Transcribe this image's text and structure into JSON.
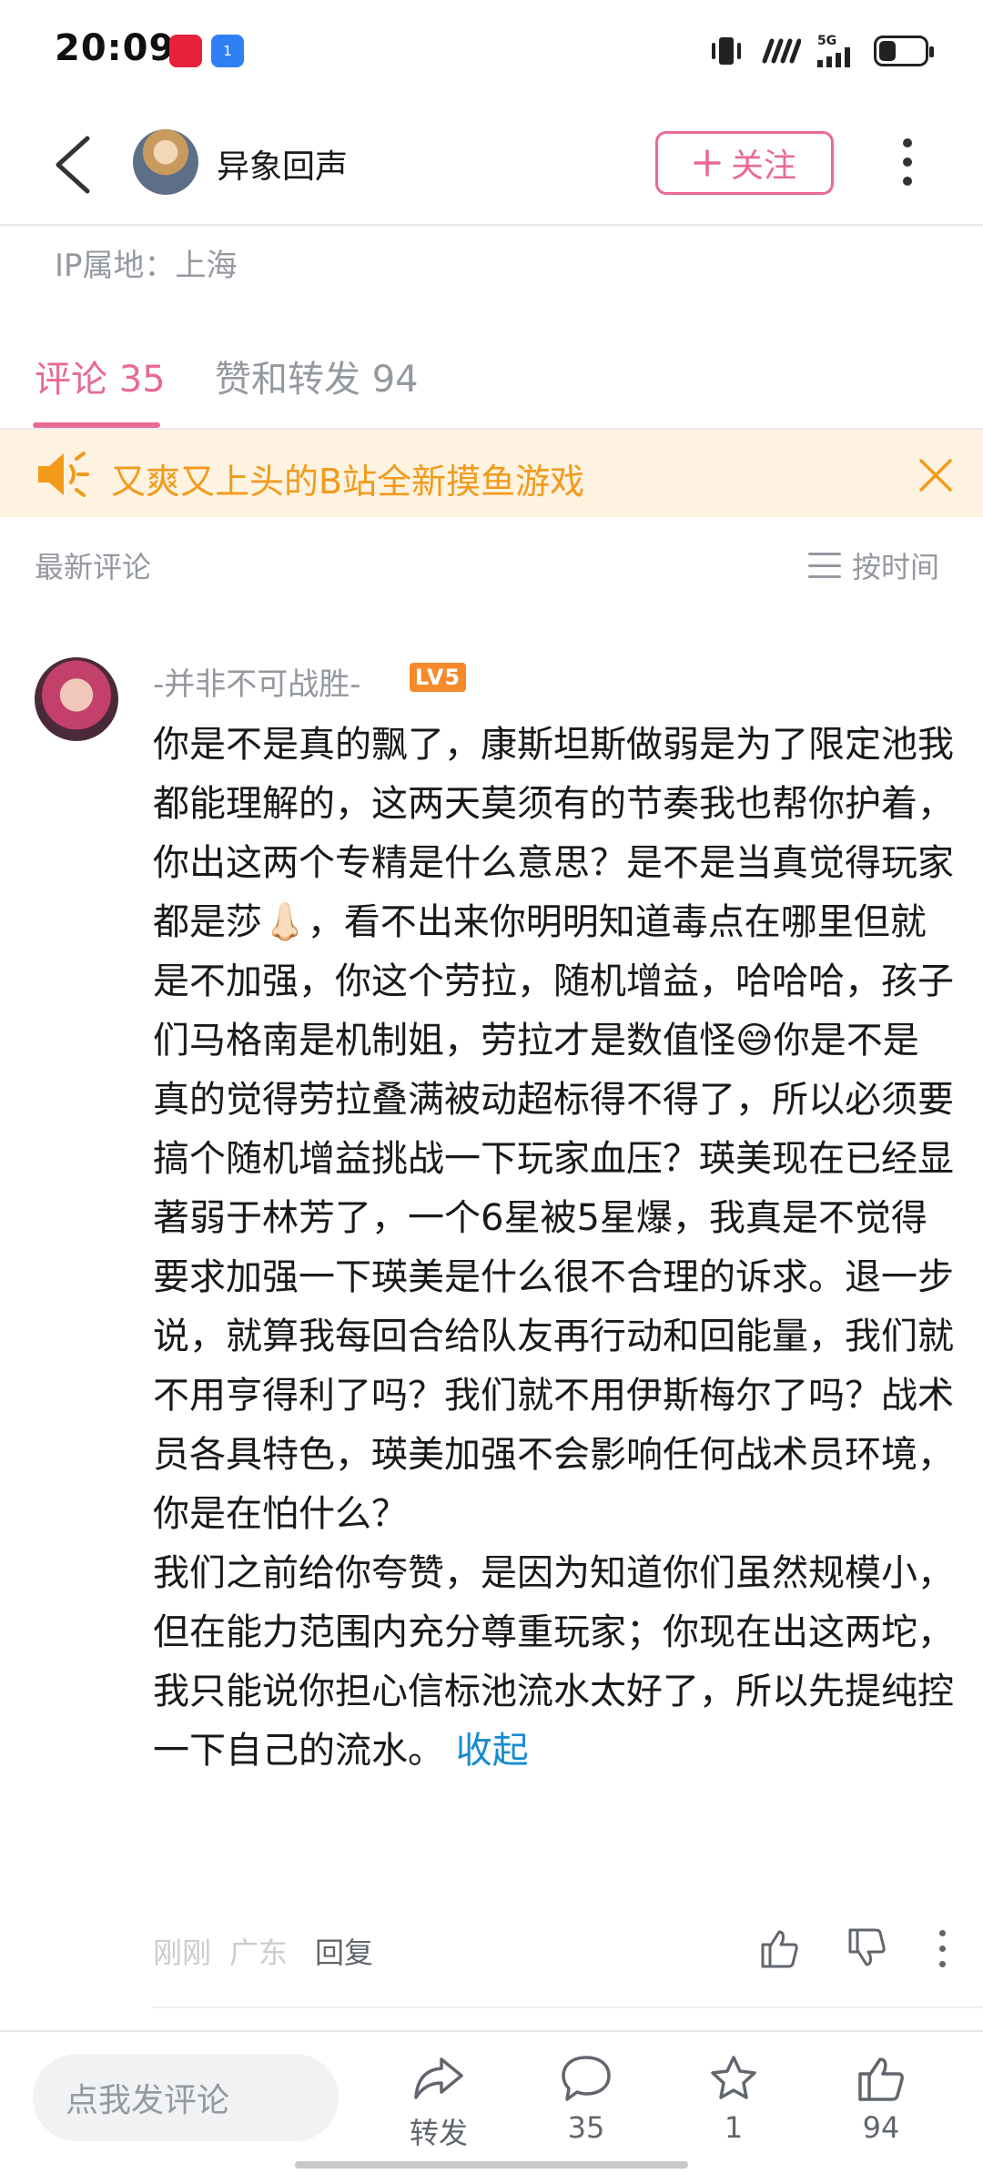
{
  "status_bar": {
    "time": "20:09",
    "notif_badge": "1",
    "network": "5G"
  },
  "header": {
    "username": "异象回声",
    "follow_label": "关注"
  },
  "profile": {
    "ip_location": "IP属地：上海"
  },
  "tabs": [
    {
      "label": "评论 35",
      "active": true
    },
    {
      "label": "赞和转发 94",
      "active": false
    }
  ],
  "notice": {
    "text": "又爽又上头的B站全新摸鱼游戏"
  },
  "sort": {
    "label": "最新评论",
    "toggle_label": "按时间"
  },
  "comment": {
    "author": "-并非不可战胜-",
    "level": "LV5",
    "paragraph1": "你是不是真的飘了，康斯坦斯做弱是为了限定池我都能理解的，这两天莫须有的节奏我也帮你护着，你出这两个专精是什么意思？是不是当真觉得玩家都是莎👃🏻，看不出来你明明知道毒点在哪里但就是不加强，你这个劳拉，随机增益，哈哈哈，孩子们马格南是机制姐，劳拉才是数值怪😅你是不是真的觉得劳拉叠满被动超标得不得了，所以必须要搞个随机增益挑战一下玩家血压？瑛美现在已经显著弱于林芳了，一个6星被5星爆，我真是不觉得要求加强一下瑛美是什么很不合理的诉求。退一步说，就算我每回合给队友再行动和回能量，我们就不用亨得利了吗？我们就不用伊斯梅尔了吗？战术员各具特色，瑛美加强不会影响任何战术员环境，你是在怕什么？",
    "paragraph2": "我们之前给你夸赞，是因为知道你们虽然规模小，但在能力范围内充分尊重玩家；你现在出这两坨，我只能说你担心信标池流水太好了，所以先提纯控一下自己的流水。",
    "collapse_label": "收起",
    "time": "刚刚",
    "location": "广东",
    "reply_label": "回复"
  },
  "bottom_bar": {
    "input_placeholder": "点我发评论",
    "share_label": "转发",
    "comment_count": "35",
    "favorite_count": "1",
    "like_count": "94"
  },
  "colors": {
    "accent": "#e86a93",
    "notice_text": "#f29a1c",
    "link": "#178bcf",
    "level_badge": "#f58a2a"
  }
}
